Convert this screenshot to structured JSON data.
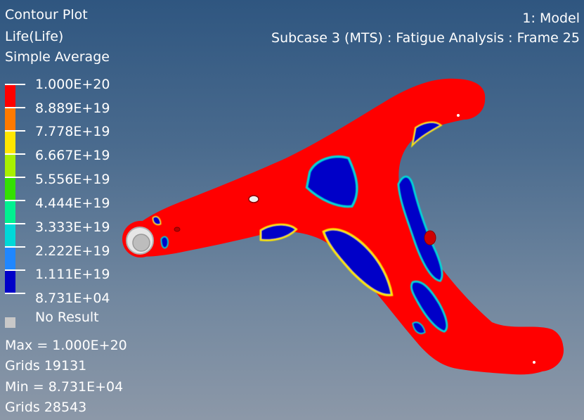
{
  "legend": {
    "title_lines": [
      "Contour Plot",
      "Life(Life)",
      "Simple Average"
    ],
    "values": [
      "1.000E+20",
      "8.889E+19",
      "7.778E+19",
      "6.667E+19",
      "5.556E+19",
      "4.444E+19",
      "3.333E+19",
      "2.222E+19",
      "1.111E+19",
      "8.731E+04"
    ],
    "colors": [
      "#ff0000",
      "#ff7a00",
      "#ffe600",
      "#a8f000",
      "#33e000",
      "#00f090",
      "#00d8d8",
      "#1f87ff",
      "#0000c8"
    ],
    "no_result_label": "No Result",
    "no_result_color": "#c8c8c8"
  },
  "stats": {
    "max_line": "Max =  1.000E+20",
    "max_grids": "Grids 19131",
    "min_line": "Min =  8.731E+04",
    "min_grids": "Grids 28543"
  },
  "header": {
    "model": "1: Model",
    "subcase": "Subcase 3 (MTS) : Fatigue Analysis : Frame 25"
  },
  "model_colors": {
    "high_life": "#ff0000",
    "low_life": "#0000c8",
    "edge_yellow": "#ffe600",
    "edge_cyan": "#00d8d8"
  }
}
